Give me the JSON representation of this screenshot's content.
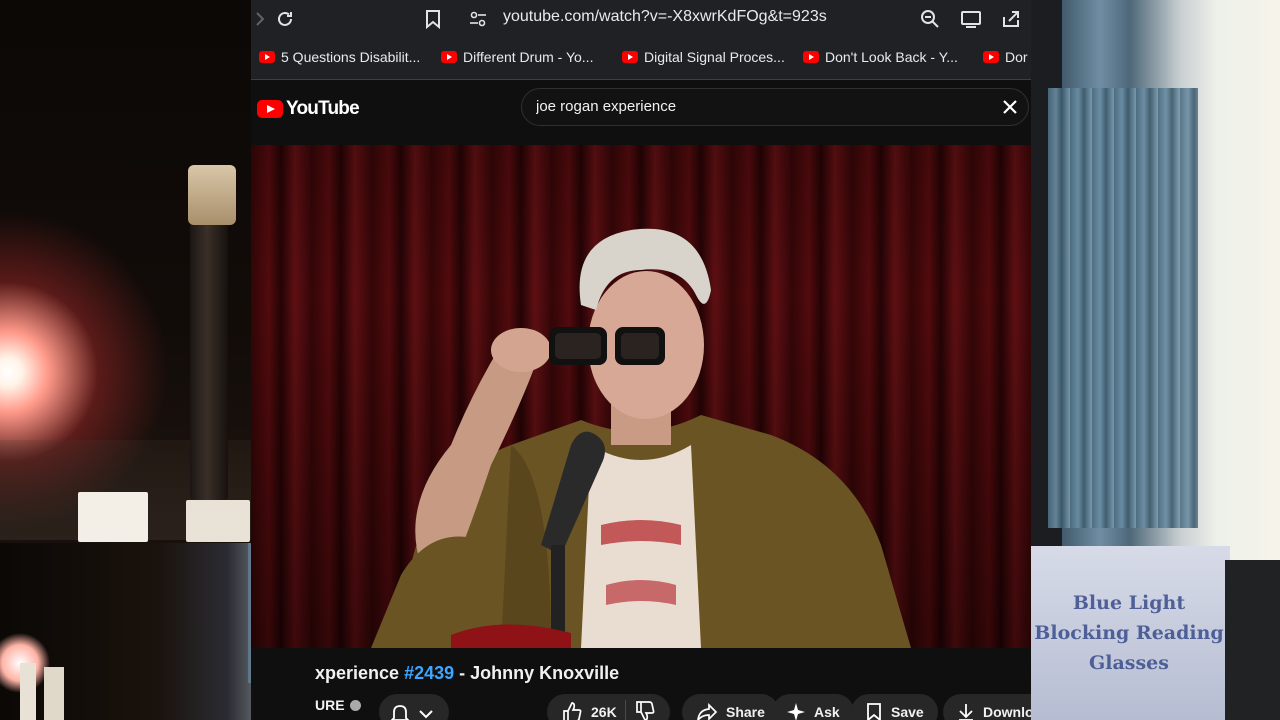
{
  "browser": {
    "url": "youtube.com/watch?v=-X8xwrKdFOg&t=923s",
    "icons": [
      "reload-icon",
      "bookmark-icon",
      "site-settings-icon",
      "zoom-icon",
      "install-icon",
      "share-icon"
    ],
    "bookmarks": [
      {
        "label": "5 Questions Disabilit..."
      },
      {
        "label": "Different Drum - Yo..."
      },
      {
        "label": "Digital Signal Proces..."
      },
      {
        "label": "Don't Look Back - Y..."
      },
      {
        "label": "Dor"
      }
    ]
  },
  "youtube": {
    "logo_text": "YouTube",
    "search": {
      "query": "joe rogan experience"
    },
    "video": {
      "title_prefix": "xperience ",
      "episode": "#2439",
      "title_suffix": " - Johnny Knoxville",
      "channel_fragment": "URE",
      "actions": {
        "likes": "26K",
        "share": "Share",
        "ask": "Ask",
        "save": "Save",
        "download": "Downlo"
      }
    }
  },
  "overlay": {
    "box_text": "Blue Light Blocking Reading Glasses"
  },
  "colors": {
    "youtube_red": "#ff0000",
    "link_blue": "#3ea6ff",
    "chrome_dark": "#202124",
    "page_bg": "#0f0f0f",
    "pill_bg": "#272727"
  }
}
